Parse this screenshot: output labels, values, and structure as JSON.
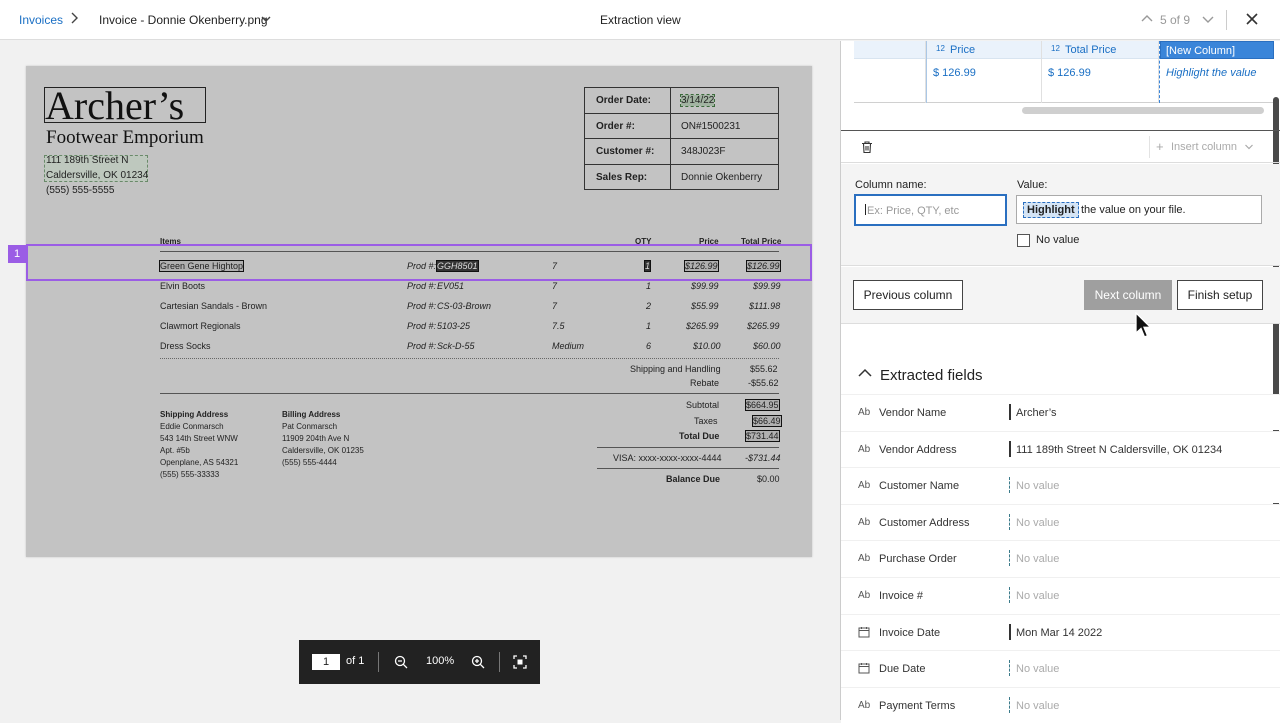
{
  "topbar": {
    "breadcrumb_link": "Invoices",
    "breadcrumb_file": "Invoice - Donnie Okenberry.png",
    "title": "Extraction view",
    "counter": "5 of 9"
  },
  "document": {
    "logo_main": "Archer’s",
    "logo_sub": "Footwear Emporium",
    "address_line1": "111 189th Street N",
    "address_line2": "Caldersville, OK 01234",
    "phone": "(555) 555-5555",
    "meta": [
      {
        "label": "Order Date:",
        "value": "3/14/22"
      },
      {
        "label": "Order #:",
        "value": "ON#1500231"
      },
      {
        "label": "Customer #:",
        "value": "348J023F"
      },
      {
        "label": "Sales Rep:",
        "value": "Donnie Okenberry"
      }
    ],
    "table_headers": {
      "items": "Items",
      "qty": "QTY",
      "price": "Price",
      "total": "Total Price"
    },
    "rows": [
      {
        "item": "Green Gene Hightop",
        "prod_label": "Prod #:",
        "prod": "GGH8501",
        "size": "7",
        "qty": "1",
        "price": "$126.99",
        "total": "$126.99"
      },
      {
        "item": "Elvin Boots",
        "prod_label": "Prod #:",
        "prod": "EV051",
        "size": "7",
        "qty": "1",
        "price": "$99.99",
        "total": "$99.99"
      },
      {
        "item": "Cartesian Sandals - Brown",
        "prod_label": "Prod #:",
        "prod": "CS-03-Brown",
        "size": "7",
        "qty": "2",
        "price": "$55.99",
        "total": "$111.98"
      },
      {
        "item": "Clawmort Regionals",
        "prod_label": "Prod #:",
        "prod": "5103-25",
        "size": "7.5",
        "qty": "1",
        "price": "$265.99",
        "total": "$265.99"
      },
      {
        "item": "Dress Socks",
        "prod_label": "Prod #:",
        "prod": "Sck-D-55",
        "size": "Medium",
        "qty": "6",
        "price": "$10.00",
        "total": "$60.00"
      }
    ],
    "shipping_label": "Shipping and Handling",
    "shipping_value": "$55.62",
    "rebate_label": "Rebate",
    "rebate_value": "-$55.62",
    "shipping_address": {
      "title": "Shipping Address",
      "lines": [
        "Eddie Conmarsch",
        "543 14th Street WNW",
        "Apt. #5b",
        "Openplane, AS 54321",
        "(555) 555-33333"
      ]
    },
    "billing_address": {
      "title": "Billing Address",
      "lines": [
        "Pat Conmarsch",
        "11909 204th Ave N",
        "Caldersville, OK 01235",
        "(555) 555-4444"
      ]
    },
    "subtotal_label": "Subtotal",
    "subtotal_value": "$664.95",
    "taxes_label": "Taxes",
    "taxes_value": "$66.49",
    "total_due_label": "Total Due",
    "total_due_value": "$731.44",
    "visa_label": "VISA: xxxx-xxxx-xxxx-4444",
    "visa_value": "-$731.44",
    "balance_label": "Balance Due",
    "balance_value": "$0.00",
    "row_tag": "1"
  },
  "zoombar": {
    "page": "1",
    "of": "of 1",
    "zoom": "100%"
  },
  "panel": {
    "table": {
      "columns": [
        {
          "type": "12",
          "label": "Price",
          "value": "$ 126.99"
        },
        {
          "type": "12",
          "label": "Total Price",
          "value": "$ 126.99"
        }
      ],
      "new_column": {
        "label": "[New Column]",
        "value": "Highlight the value"
      }
    },
    "insert_column": "Insert column",
    "form": {
      "column_name_label": "Column name:",
      "column_name_placeholder": "Ex: Price, QTY, etc",
      "value_label": "Value:",
      "value_highlight": "Highlight",
      "value_rest": "the value on your file.",
      "no_value_label": "No value"
    },
    "buttons": {
      "previous": "Previous column",
      "next": "Next column",
      "finish": "Finish setup"
    },
    "extracted_title": "Extracted fields",
    "fields": [
      {
        "icon": "Ab",
        "name": "Vendor Name",
        "value": "Archer’s",
        "empty": false
      },
      {
        "icon": "Ab",
        "name": "Vendor Address",
        "value": "111 189th Street N Caldersville, OK 01234",
        "empty": false
      },
      {
        "icon": "Ab",
        "name": "Customer Name",
        "value": "No value",
        "empty": true
      },
      {
        "icon": "Ab",
        "name": "Customer Address",
        "value": "No value",
        "empty": true
      },
      {
        "icon": "Ab",
        "name": "Purchase Order",
        "value": "No value",
        "empty": true
      },
      {
        "icon": "Ab",
        "name": "Invoice #",
        "value": "No value",
        "empty": true
      },
      {
        "icon": "calendar",
        "name": "Invoice Date",
        "value": "Mon Mar 14 2022",
        "empty": false
      },
      {
        "icon": "calendar",
        "name": "Due Date",
        "value": "No value",
        "empty": true
      },
      {
        "icon": "Ab",
        "name": "Payment Terms",
        "value": "No value",
        "empty": true
      }
    ]
  }
}
